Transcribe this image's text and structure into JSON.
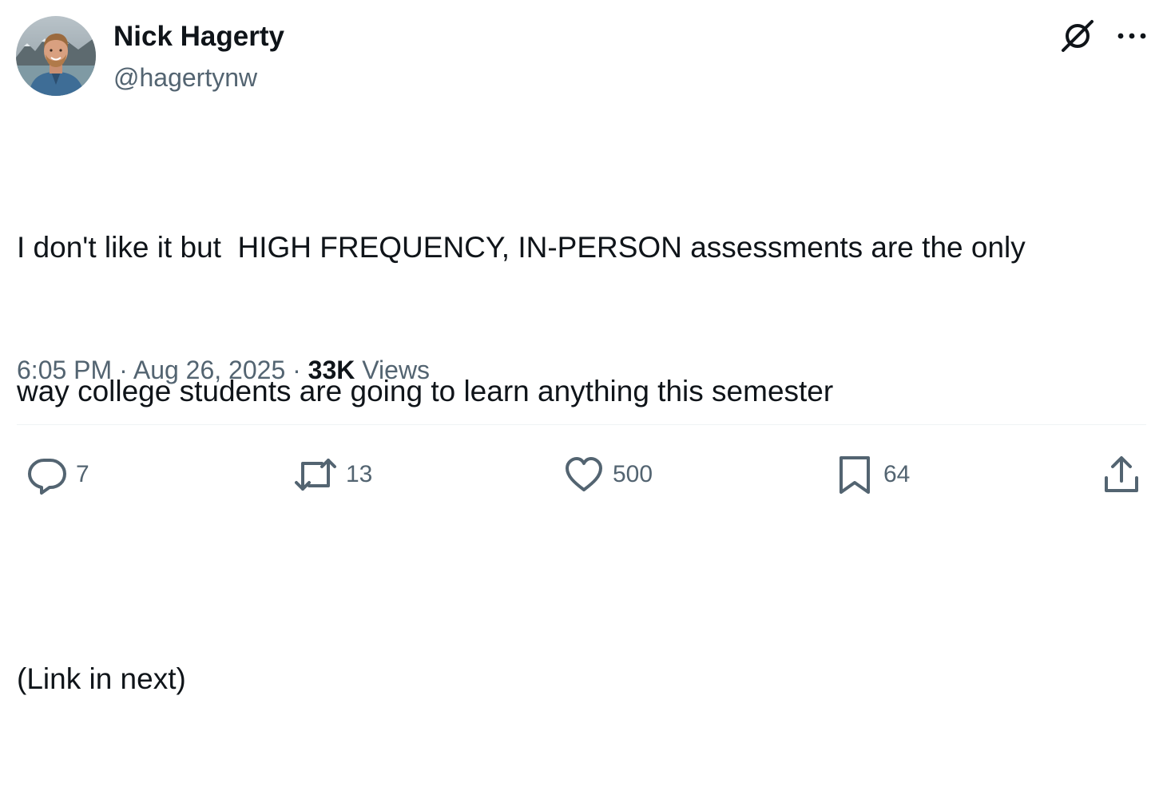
{
  "author": {
    "name": "Nick Hagerty",
    "handle": "@hagertynw",
    "avatar_icon": "profile-photo"
  },
  "tweet": {
    "lines": [
      "I don't like it but  HIGH FREQUENCY, IN-PERSON assessments are the only",
      "way college students are going to learn anything this semester",
      "(Link in next)"
    ]
  },
  "meta": {
    "time": "6:05 PM",
    "separator": "·",
    "date": "Aug 26, 2025",
    "views_count": "33K",
    "views_label": "Views"
  },
  "actions": {
    "replies": "7",
    "reposts": "13",
    "likes": "500",
    "bookmarks": "64"
  },
  "icons": {
    "grok": "grok-icon",
    "more": "more-icon",
    "reply": "reply-icon",
    "repost": "repost-icon",
    "like": "heart-icon",
    "bookmark": "bookmark-icon",
    "share": "share-icon"
  },
  "colors": {
    "text_primary": "#0f1419",
    "text_secondary": "#536471",
    "divider": "#eff3f4"
  }
}
